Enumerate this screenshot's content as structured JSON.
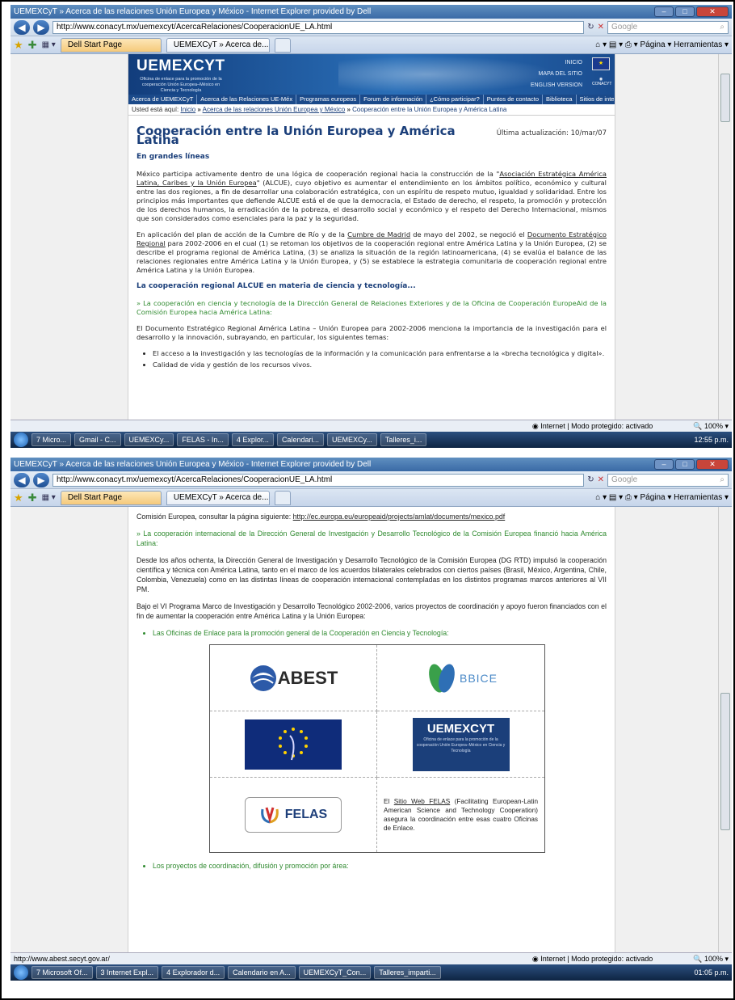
{
  "window": {
    "title": "UEMEXCyT » Acerca de las relaciones Unión Europea y México - Internet Explorer provided by Dell",
    "url": "http://www.conacyt.mx/uemexcyt/AcercaRelaciones/CooperacionUE_LA.html",
    "search_placeholder": "Google",
    "tab_home": "Dell Start Page",
    "tab_active": "UEMEXCyT » Acerca de...",
    "tools": "Página ▾  Herramientas ▾",
    "zoom": "100%"
  },
  "status1": {
    "left": "",
    "mid": "Internet | Modo protegido: activado"
  },
  "status2": {
    "left": "http://www.abest.secyt.gov.ar/",
    "mid": "Internet | Modo protegido: activado"
  },
  "taskbar1": {
    "tasks": [
      "7 Micro...",
      "Gmail - C...",
      "UEMEXCy...",
      "FELAS - In...",
      "4 Explor...",
      "Calendari...",
      "UEMEXCy...",
      "Talleres_i..."
    ],
    "time": "12:55 p.m."
  },
  "taskbar2": {
    "tasks": [
      "7 Microsoft Of...",
      "3 Internet Expl...",
      "4 Explorador d...",
      "Calendario en A...",
      "UEMEXCyT_Con...",
      "Talleres_imparti..."
    ],
    "time": "01:05 p.m."
  },
  "site": {
    "logo": "UEMEXCYT",
    "logo_sub": "Oficina de enlace para la promoción de la cooperación Unión Europea–México en Ciencia y Tecnología",
    "top_links": [
      "INICIO",
      "MAPA DEL SITIO",
      "ENGLISH VERSION"
    ],
    "conacyt": "CONACYT",
    "menu": [
      "Acerca de UEMEXCyT",
      "Acerca de las Relaciones UE-Méx",
      "Programas europeos",
      "Forum de información",
      "¿Cómo participar?",
      "Puntos de contacto",
      "Biblioteca",
      "Sitios de interés"
    ],
    "breadcrumb_prefix": "Usted está aquí:",
    "breadcrumb_1": "Inicio",
    "breadcrumb_2": "Acerca de las relaciones Unión Europea y México",
    "breadcrumb_3": "Cooperación entre la Unión Europea y América Latina",
    "sep": "»"
  },
  "article": {
    "title": "Cooperación entre la Unión Europea y América Latina",
    "updated": "Última actualización: 10/mar/07",
    "h_overview": "En grandes líneas",
    "p1_a": "México participa activamente dentro de una lógica de cooperación regional hacia la construcción de la \"",
    "p1_link": "Asociación Estratégica América Latina, Caribes y la Unión Europea",
    "p1_b": "\" (ALCUE), cuyo objetivo es aumentar el entendimiento en los ámbitos político, económico y cultural entre las dos regiones, a fin de desarrollar una colaboración estratégica, con un espíritu de respeto mutuo, igualdad y solidaridad. Entre los principios más importantes que defiende ALCUE está el de que la democracia, el Estado de derecho, el respeto, la promoción y protección de los derechos humanos, la erradicación de la pobreza, el desarrollo social y económico y el respeto del Derecho Internacional, mismos que son considerados como esenciales para la paz y la seguridad.",
    "p2_a": "En aplicación del plan de acción de la Cumbre de Río y de la ",
    "p2_link1": "Cumbre de Madrid",
    "p2_b": " de mayo del 2002, se negoció el ",
    "p2_link2": "Documento Estratégico Regional",
    "p2_c": " para 2002-2006 en el cual (1) se retoman los objetivos de la cooperación regional entre América Latina y la Unión Europea, (2) se describe el programa regional de América Latina, (3) se analiza la situación de la región latinoamericana, (4) se evalúa el balance de las relaciones regionales entre América Latina y la Unión Europea, y (5) se establece la estrategia comunitaria de cooperación regional entre América Latina y la Unión Europea.",
    "h_alcue": "La cooperación regional ALCUE en materia de ciencia y tecnología...",
    "g1": "» La cooperación en ciencia y tecnología de la Dirección General de Relaciones Exteriores y de la Oficina de Cooperación EuropeAid de la Comisión Europea hacia América Latina:",
    "p3": "El Documento Estratégico Regional América Latina – Unión Europea para 2002-2006 menciona la importancia de la investigación para el desarrollo y la innovación, subrayando, en particular, los siguientes temas:",
    "b1": "El acceso a la investigación y las tecnologías de la información y la comunicación para enfrentarse a la «brecha tecnológica y digital».",
    "b2": "Calidad de vida y gestión de los recursos vivos."
  },
  "article2": {
    "line_a": "Comisión Europea, consultar la página siguiente: ",
    "line_link": "http://ec.europa.eu/europeaid/projects/amlat/documents/mexico.pdf",
    "g2": "» La cooperación internacional de la Dirección General de Investgación y Desarrollo Tecnológico de la Comisión Europea financió hacia América Latina:",
    "p4": "Desde los años ochenta, la Dirección General de Investigación y Desarrollo Tecnológico de la Comisión Europea (DG RTD) impulsó la cooperación científica y técnica con América Latina, tanto en el marco de los acuerdos bilaterales celebrados con ciertos países (Brasil, México, Argentina, Chile, Colombia, Venezuela) como en las distintas líneas de cooperación internacional contempladas en los distintos programas marcos anteriores al VII PM.",
    "p5": "Bajo el VI Programa Marco de Investigación y Desarrollo Tecnológico 2002-2006, varios proyectos de coordinación y apoyo fueron financiados con el fin de aumentar la cooperación entre América Latina y la Unión Europea:",
    "b3": "Las Oficinas de Enlace para la promoción general de la Cooperación en Ciencia y Tecnología:",
    "logo_abest": "ABEST",
    "logo_bbice": "BBICE",
    "logo_uem": "UEMEXCYT",
    "logo_uem_sub": "Oficina de enlace para la promoción de la cooperación Unión Europea–México en Ciencia y Tecnología",
    "logo_felas": "FELAS",
    "felas_a": "El ",
    "felas_link": "Sitio Web FELAS",
    "felas_b": " (Facilitating European-Latin American Science and Technology Cooperation) asegura la coordinación entre esas cuatro Oficinas de Enlace.",
    "b4": "Los proyectos de coordinación, difusión y promoción por área:"
  }
}
